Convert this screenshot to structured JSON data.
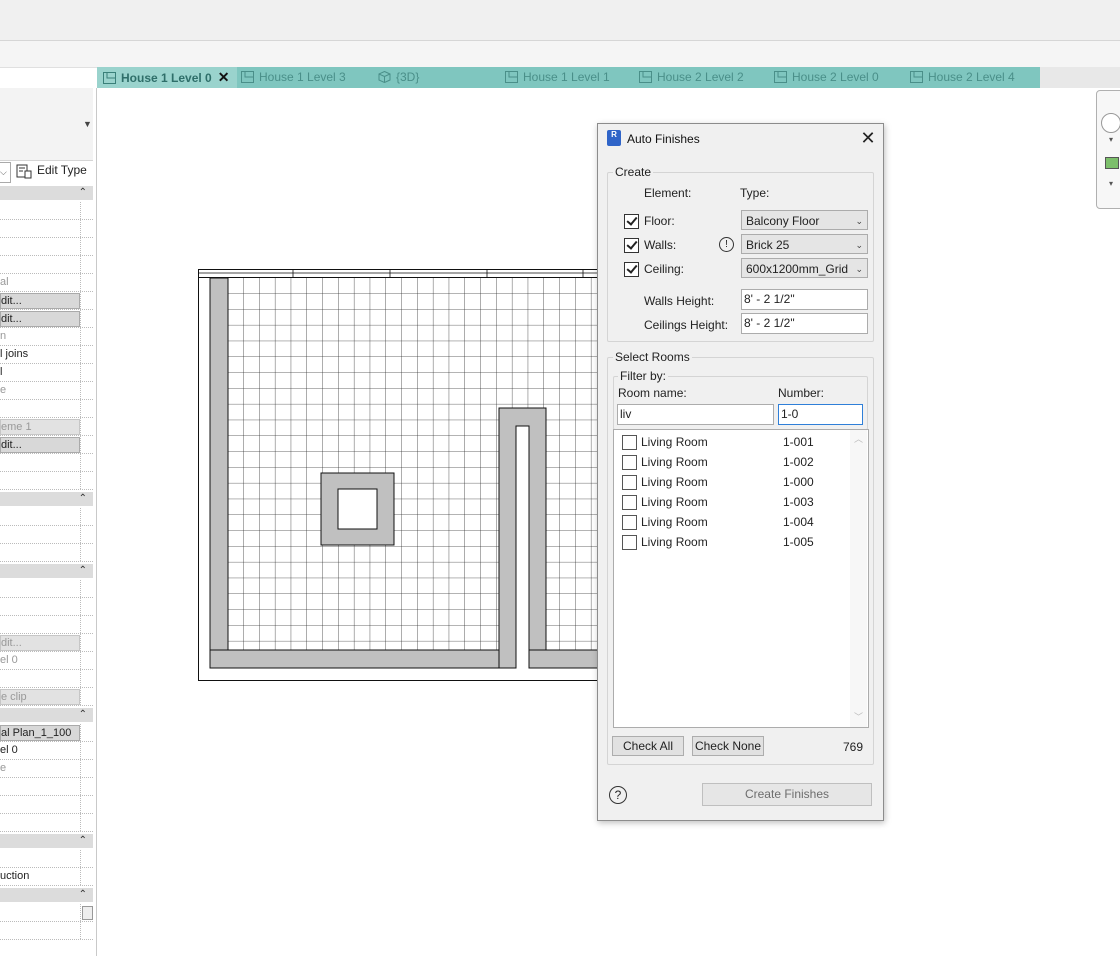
{
  "tabs": [
    {
      "label": "House 1 Level 0",
      "active": true,
      "close": "✕"
    },
    {
      "label": "House 1 Level 3"
    },
    {
      "label": "{3D}"
    },
    {
      "label": "House 1 Level 1"
    },
    {
      "label": "House 2 Level 2"
    },
    {
      "label": "House 2 Level 0"
    },
    {
      "label": "House 2 Level 4"
    }
  ],
  "properties": {
    "edit_type_label": "Edit Type",
    "rows": [
      "al",
      "dit...",
      "dit...",
      "n",
      "l joins",
      "l",
      "e",
      "eme 1",
      "dit...",
      "dit...",
      "el 0",
      "e clip",
      "al Plan_1_100",
      "el 0",
      "e",
      "uction"
    ]
  },
  "dialog": {
    "title": "Auto Finishes",
    "icon_text": "R",
    "close": "✕",
    "create": {
      "legend": "Create",
      "element_header": "Element:",
      "type_header": "Type:",
      "floor": {
        "label": "Floor:",
        "checked": true,
        "type": "Balcony Floor"
      },
      "walls": {
        "label": "Walls:",
        "checked": true,
        "type": "Brick 25",
        "warning": "!"
      },
      "ceiling": {
        "label": "Ceiling:",
        "checked": true,
        "type": "600x1200mm_Grid"
      },
      "walls_height": {
        "label": "Walls Height:",
        "value": "8' - 2 1/2\""
      },
      "ceilings_height": {
        "label": "Ceilings Height:",
        "value": "8' - 2 1/2\""
      }
    },
    "select_rooms": {
      "legend": "Select Rooms",
      "filter_legend": "Filter by:",
      "room_name_label": "Room name:",
      "number_label": "Number:",
      "room_name_value": "liv",
      "number_value": "1-0",
      "rooms": [
        {
          "name": "Living Room",
          "number": "1-001"
        },
        {
          "name": "Living Room",
          "number": "1-002"
        },
        {
          "name": "Living Room",
          "number": "1-000"
        },
        {
          "name": "Living Room",
          "number": "1-003"
        },
        {
          "name": "Living Room",
          "number": "1-004"
        },
        {
          "name": "Living Room",
          "number": "1-005"
        }
      ],
      "check_all": "Check All",
      "check_none": "Check None",
      "count": "769"
    },
    "help": "?",
    "create_button": "Create Finishes"
  }
}
